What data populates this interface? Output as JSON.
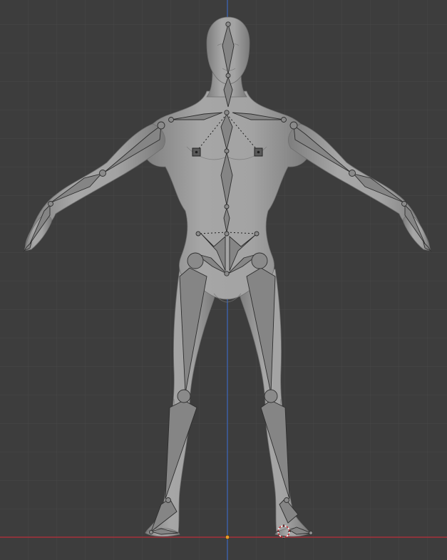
{
  "viewport": {
    "view": "front-orthographic",
    "grid": true,
    "background": "#3d3d3d",
    "grid_color": "#4a4a4a",
    "axis_x_color": "#a8333d",
    "axis_z_color": "#3f63a8",
    "origin_color": "#e89a2a"
  },
  "scene": {
    "mesh": "humanoid-body",
    "mesh_color": "#9b9b9b",
    "armature": "humanoid-armature",
    "armature_color": "#7a7a7a",
    "cursor_icon": "3d-cursor-icon"
  }
}
